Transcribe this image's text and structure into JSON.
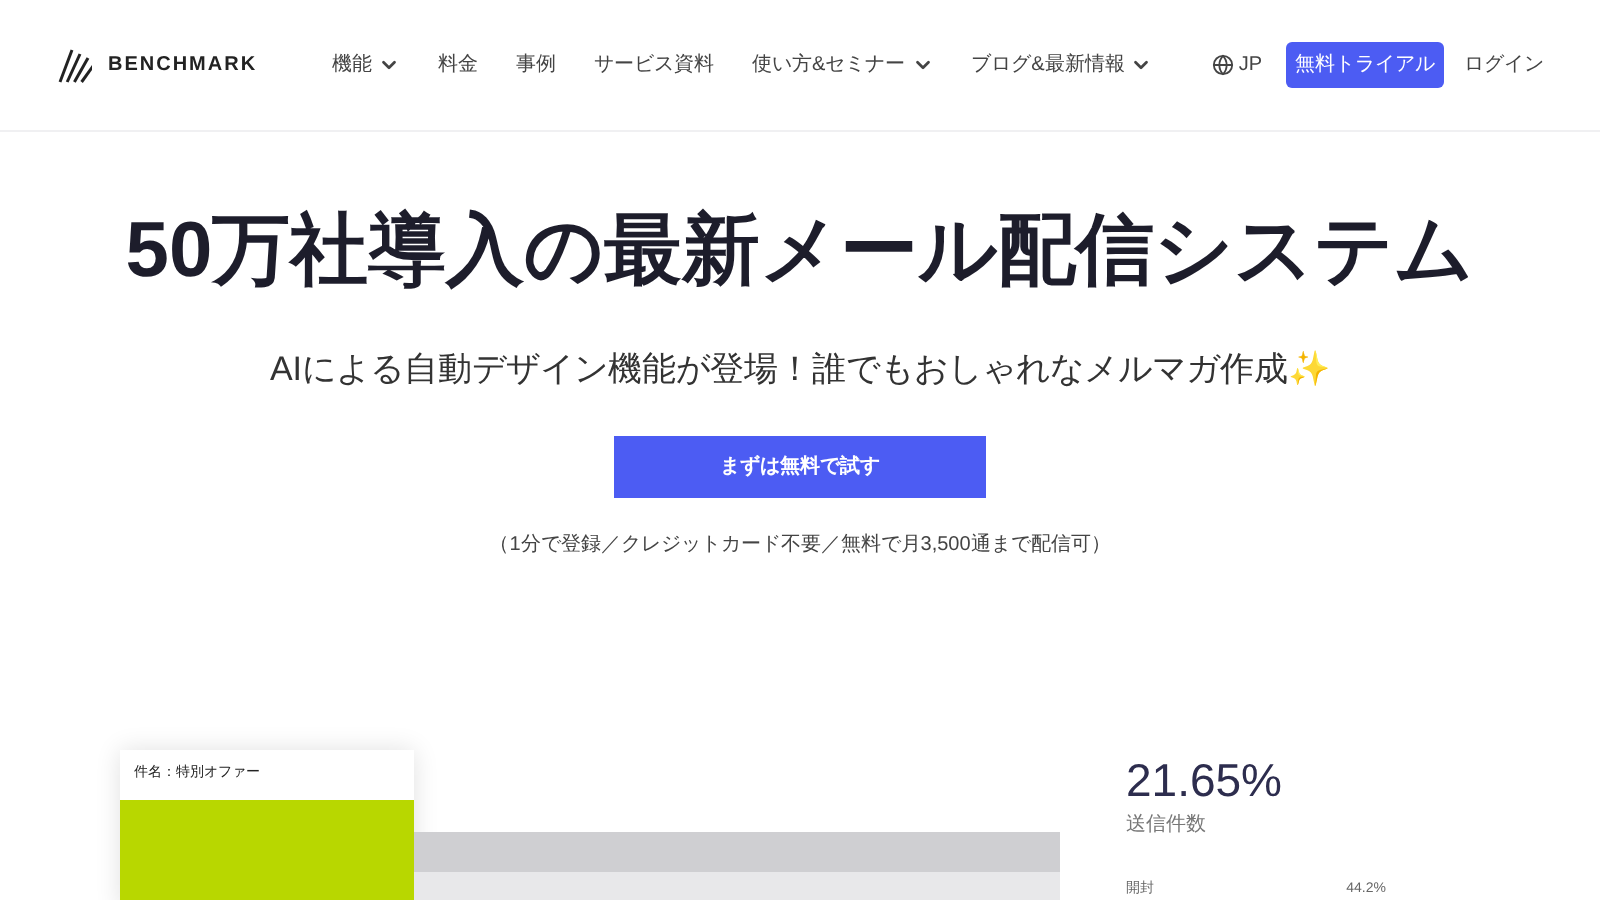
{
  "logo": {
    "text": "BENCHMARK"
  },
  "nav": [
    {
      "label": "機能",
      "dropdown": true
    },
    {
      "label": "料金",
      "dropdown": false
    },
    {
      "label": "事例",
      "dropdown": false
    },
    {
      "label": "サービス資料",
      "dropdown": false
    },
    {
      "label": "使い方&セミナー",
      "dropdown": true
    },
    {
      "label": "ブログ&最新情報",
      "dropdown": true
    }
  ],
  "language": "JP",
  "trial_button": "無料トライアル",
  "login": "ログイン",
  "hero": {
    "title": "50万社導入の最新メール配信システム",
    "subtitle": "AIによる自動デザイン機能が登場！誰でもおしゃれなメルマガ作成✨",
    "cta": "まずは無料で試す",
    "note": "（1分で登録／クレジットカード不要／無料で月3,500通まで配信可）"
  },
  "preview": {
    "subject": "件名：特別オファー"
  },
  "stats": {
    "value": "21.65%",
    "label": "送信件数",
    "rows": [
      {
        "name": "開封",
        "value": "44.2%"
      }
    ]
  }
}
